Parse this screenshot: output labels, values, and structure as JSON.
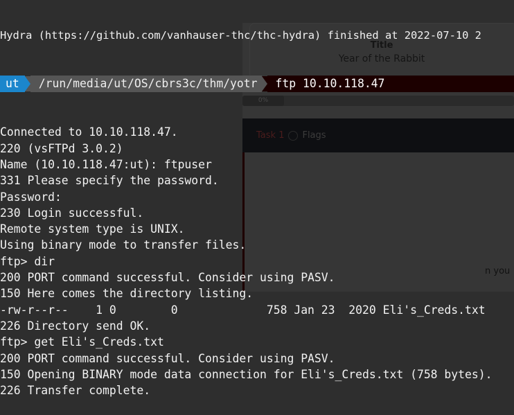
{
  "background_page": {
    "card_title": "Title",
    "card_value": "Year of the Rabbit",
    "progress_label": "0%",
    "progress_percent": 0,
    "task_number": "Task 1",
    "task_name": "Flags",
    "side_text": "n you"
  },
  "terminal": {
    "top_line": "Hydra (https://github.com/vanhauser-thc/thc-hydra) finished at 2022-07-10 2",
    "prompt": {
      "user": "ut",
      "path": "/run/media/ut/OS/cbrs3c/thm/yotr",
      "command": "ftp 10.10.118.47"
    },
    "lines": [
      "Connected to 10.10.118.47.",
      "220 (vsFTPd 3.0.2)",
      "Name (10.10.118.47:ut): ftpuser",
      "331 Please specify the password.",
      "Password:",
      "230 Login successful.",
      "Remote system type is UNIX.",
      "Using binary mode to transfer files.",
      "ftp> dir",
      "200 PORT command successful. Consider using PASV.",
      "150 Here comes the directory listing.",
      "-rw-r--r--    1 0        0             758 Jan 23  2020 Eli's_Creds.txt",
      "226 Directory send OK.",
      "ftp> get Eli's_Creds.txt",
      "200 PORT command successful. Consider using PASV.",
      "150 Opening BINARY mode data connection for Eli's_Creds.txt (758 bytes).",
      "226 Transfer complete."
    ]
  }
}
